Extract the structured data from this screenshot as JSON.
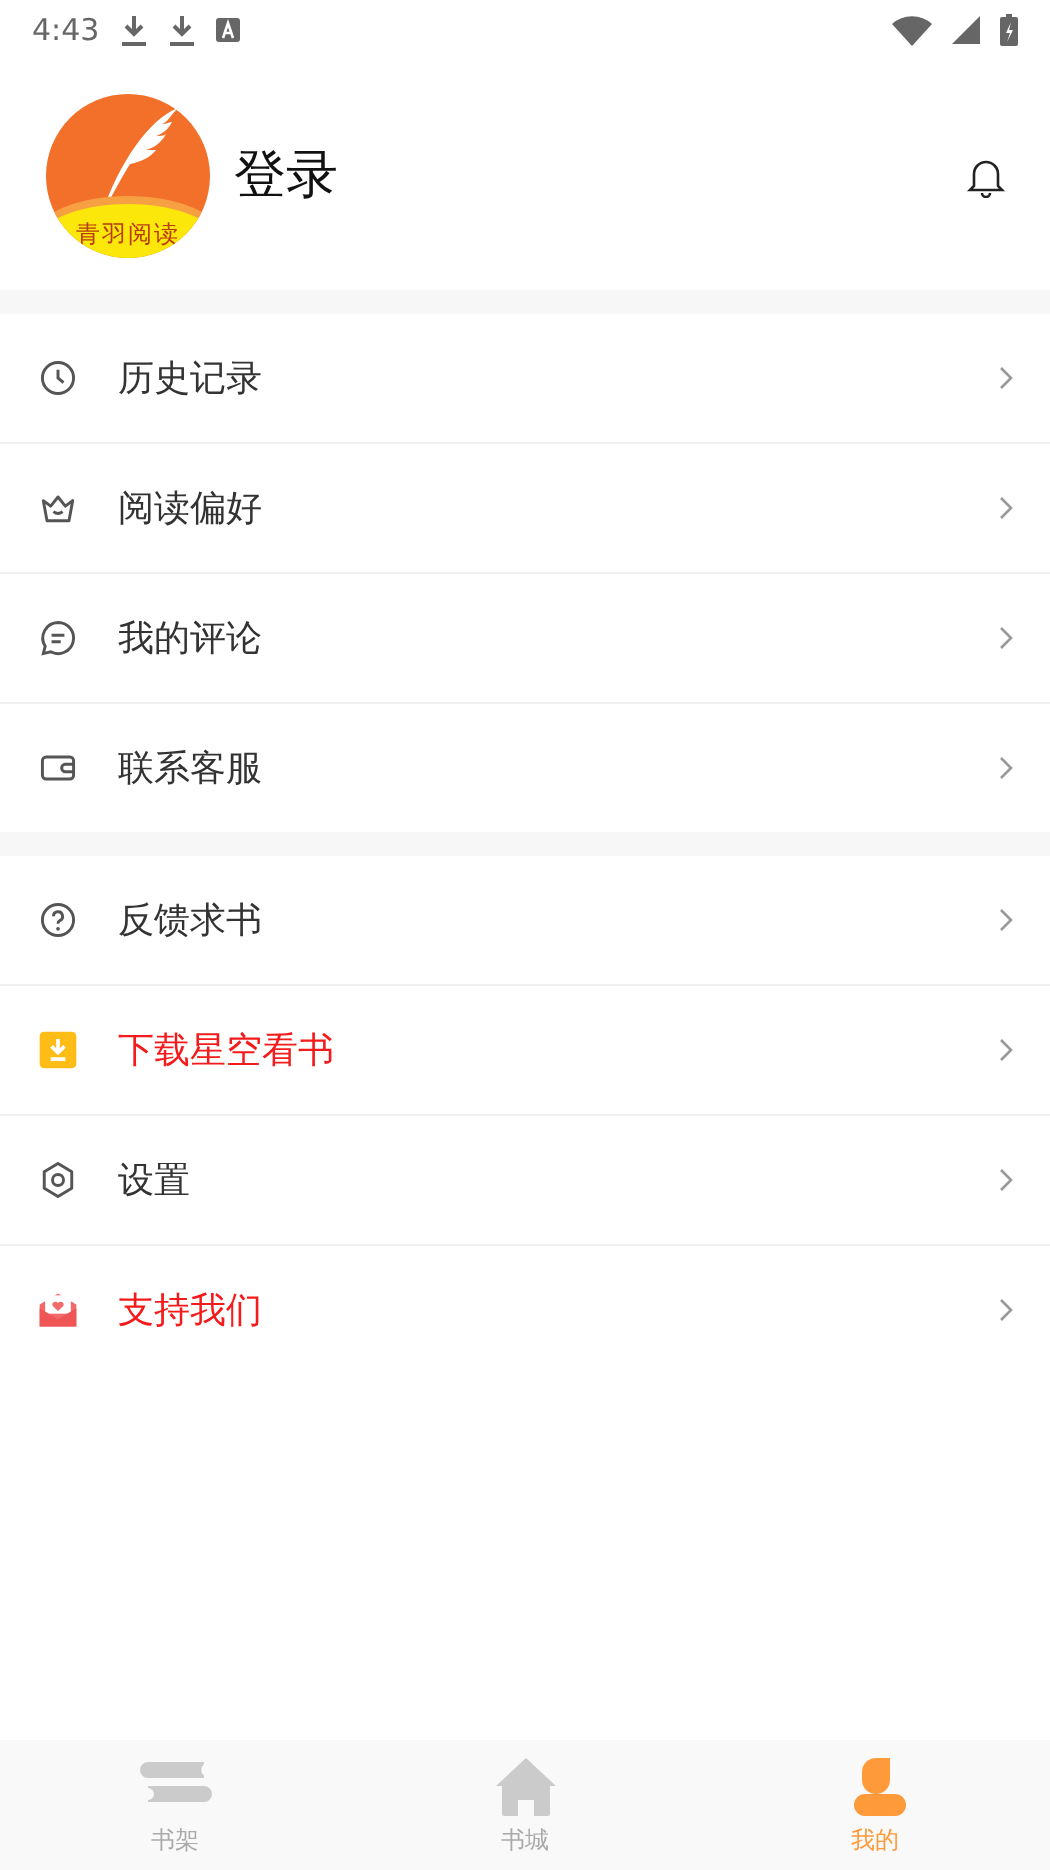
{
  "status_bar": {
    "time": "4:43"
  },
  "header": {
    "logo_text": "青羽阅读",
    "login": "登录"
  },
  "sections": [
    {
      "items": [
        {
          "kind": "clock",
          "label": "历史记录",
          "highlight": false
        },
        {
          "kind": "crown",
          "label": "阅读偏好",
          "highlight": false
        },
        {
          "kind": "comment",
          "label": "我的评论",
          "highlight": false
        },
        {
          "kind": "wallet",
          "label": "联系客服",
          "highlight": false
        }
      ]
    },
    {
      "items": [
        {
          "kind": "help",
          "label": "反馈求书",
          "highlight": false
        },
        {
          "kind": "download",
          "label": "下载星空看书",
          "highlight": true
        },
        {
          "kind": "gear",
          "label": "设置",
          "highlight": false
        },
        {
          "kind": "envelope",
          "label": "支持我们",
          "highlight": true
        }
      ]
    }
  ],
  "tabs": [
    {
      "kind": "books",
      "label": "书架",
      "selected": false
    },
    {
      "kind": "home",
      "label": "书城",
      "selected": false
    },
    {
      "kind": "person",
      "label": "我的",
      "selected": true
    }
  ]
}
